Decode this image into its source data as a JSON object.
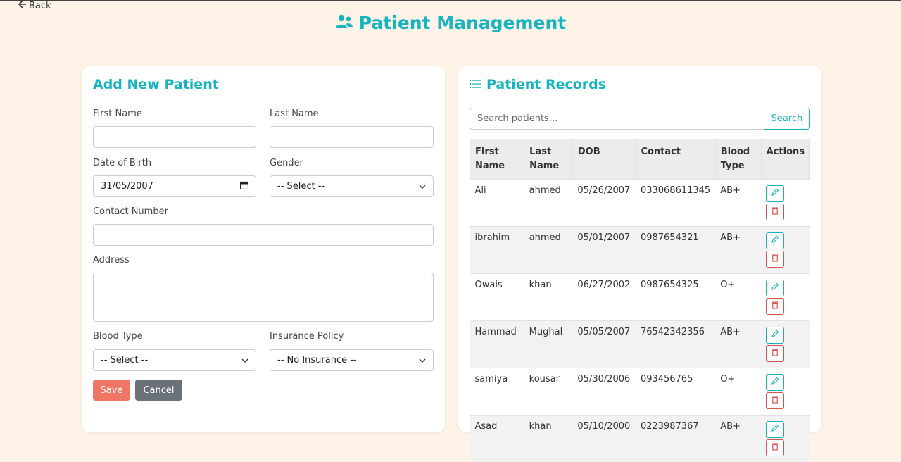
{
  "nav": {
    "back_label": "Back"
  },
  "header": {
    "title": "Patient Management"
  },
  "form": {
    "title": "Add New Patient",
    "first_name_label": "First Name",
    "first_name_value": "",
    "last_name_label": "Last Name",
    "last_name_value": "",
    "dob_label": "Date of Birth",
    "dob_value": "31/05/2007",
    "gender_label": "Gender",
    "gender_value": "-- Select --",
    "contact_label": "Contact Number",
    "contact_value": "",
    "address_label": "Address",
    "address_value": "",
    "blood_label": "Blood Type",
    "blood_value": "-- Select --",
    "insurance_label": "Insurance Policy",
    "insurance_value": "-- No Insurance --",
    "save_label": "Save",
    "cancel_label": "Cancel"
  },
  "records": {
    "title": "Patient Records",
    "search_placeholder": "Search patients...",
    "search_button": "Search",
    "columns": [
      "First Name",
      "Last Name",
      "DOB",
      "Contact",
      "Blood Type",
      "Actions"
    ],
    "rows": [
      {
        "first": "Ali",
        "last": "ahmed",
        "dob": "05/26/2007",
        "contact": "033068611345",
        "blood": "AB+"
      },
      {
        "first": "ibrahim",
        "last": "ahmed",
        "dob": "05/01/2007",
        "contact": "0987654321",
        "blood": "AB+"
      },
      {
        "first": "Owais",
        "last": "khan",
        "dob": "06/27/2002",
        "contact": "0987654325",
        "blood": "O+"
      },
      {
        "first": "Hammad",
        "last": "Mughal",
        "dob": "05/05/2007",
        "contact": "76542342356",
        "blood": "AB+"
      },
      {
        "first": "samiya",
        "last": "kousar",
        "dob": "05/30/2006",
        "contact": "093456765",
        "blood": "O+"
      },
      {
        "first": "Asad",
        "last": "khan",
        "dob": "05/10/2000",
        "contact": "0223987367",
        "blood": "AB+"
      }
    ]
  },
  "colors": {
    "accent": "#17b3c1",
    "save": "#f07565",
    "cancel": "#6b7178",
    "danger": "#d9534f",
    "background": "#fdf3e6"
  }
}
